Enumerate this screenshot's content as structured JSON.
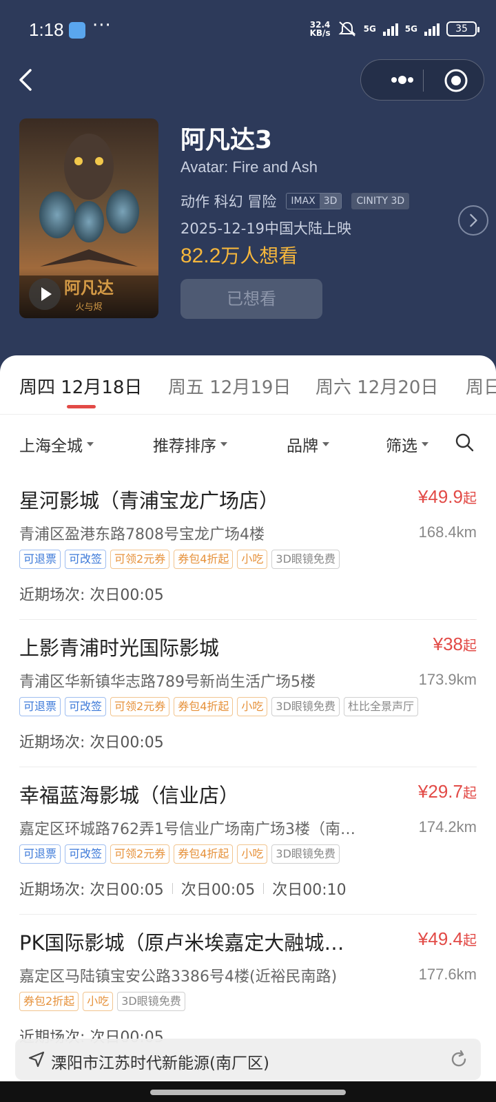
{
  "status_bar": {
    "time": "1:18",
    "dots": "···",
    "net_speed_value": "32.4",
    "net_speed_unit": "KB/s",
    "sim1_label": "5G",
    "sim2_label": "5G",
    "battery": "35"
  },
  "movie": {
    "title": "阿凡达3",
    "english_title": "Avatar: Fire and Ash",
    "genres": "动作 科幻 冒险",
    "format_imax": "IMAX",
    "format_3d": "3D",
    "format_cinity": "CINITY 3D",
    "release": "2025-12-19中国大陆上映",
    "wants_count": "82.2",
    "wants_suffix": "万人想看",
    "wanted_button": "已想看",
    "poster_text": "阿凡达",
    "poster_subtext": "火与烬"
  },
  "date_tabs": [
    {
      "label": "周四 12月18日"
    },
    {
      "label": "周五 12月19日"
    },
    {
      "label": "周六 12月20日"
    },
    {
      "label": "周日"
    }
  ],
  "filters": {
    "city": "上海全城",
    "sort": "推荐排序",
    "brand": "品牌",
    "filter": "筛选"
  },
  "cinemas": [
    {
      "name": "星河影城（青浦宝龙广场店）",
      "price": "¥49.9",
      "price_suffix": "起",
      "address": "青浦区盈港东路7808号宝龙广场4楼",
      "distance": "168.4km",
      "tags": [
        "可退票",
        "可改签",
        "可领2元券",
        "券包4折起",
        "小吃",
        "3D眼镜免费"
      ],
      "shows": [
        "近期场次: 次日00:05"
      ]
    },
    {
      "name": "上影青浦时光国际影城",
      "price": "¥38",
      "price_suffix": "起",
      "address": "青浦区华新镇华志路789号新尚生活广场5楼",
      "distance": "173.9km",
      "tags": [
        "可退票",
        "可改签",
        "可领2元券",
        "券包4折起",
        "小吃",
        "3D眼镜免费",
        "杜比全景声厅"
      ],
      "shows": [
        "近期场次: 次日00:05"
      ]
    },
    {
      "name": "幸福蓝海影城（信业店）",
      "price": "¥29.7",
      "price_suffix": "起",
      "address": "嘉定区环城路762弄1号信业广场南广场3楼（南…",
      "distance": "174.2km",
      "tags": [
        "可退票",
        "可改签",
        "可领2元券",
        "券包4折起",
        "小吃",
        "3D眼镜免费"
      ],
      "shows": [
        "近期场次: 次日00:05",
        "次日00:05",
        "次日00:10"
      ]
    },
    {
      "name": "PK国际影城（原卢米埃嘉定大融城…",
      "price": "¥49.4",
      "price_suffix": "起",
      "address": "嘉定区马陆镇宝安公路3386号4楼(近裕民南路)",
      "distance": "177.6km",
      "tags": [
        "券包2折起",
        "小吃",
        "3D眼镜免费"
      ],
      "shows": [
        "近期场次: 次日00:05"
      ]
    }
  ],
  "location_bar": {
    "text": "溧阳市江苏时代新能源(南厂区)"
  },
  "colors": {
    "header_bg": "#2d3a5a",
    "accent_red": "#e24a46",
    "wants_orange": "#f6b73c",
    "tag_blue": "#3b78d8",
    "tag_orange": "#e6913a"
  }
}
